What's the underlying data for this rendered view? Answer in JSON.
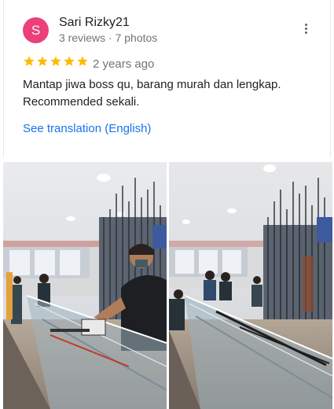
{
  "review": {
    "avatar_initial": "S",
    "avatar_color": "#ec407a",
    "author_name": "Sari Rizky21",
    "author_meta": "3 reviews · 7 photos",
    "rating": 5,
    "rating_max": 5,
    "time_ago": "2 years ago",
    "text_line1": "Mantap jiwa boss qu, barang murah dan lengkap.",
    "text_line2": "Recommended sekali.",
    "translate_link": "See translation (English)",
    "more_icon": "more-vert-icon",
    "star_color": "#fbbc04"
  },
  "photos": [
    {
      "name": "review-photo-1"
    },
    {
      "name": "review-photo-2"
    }
  ]
}
